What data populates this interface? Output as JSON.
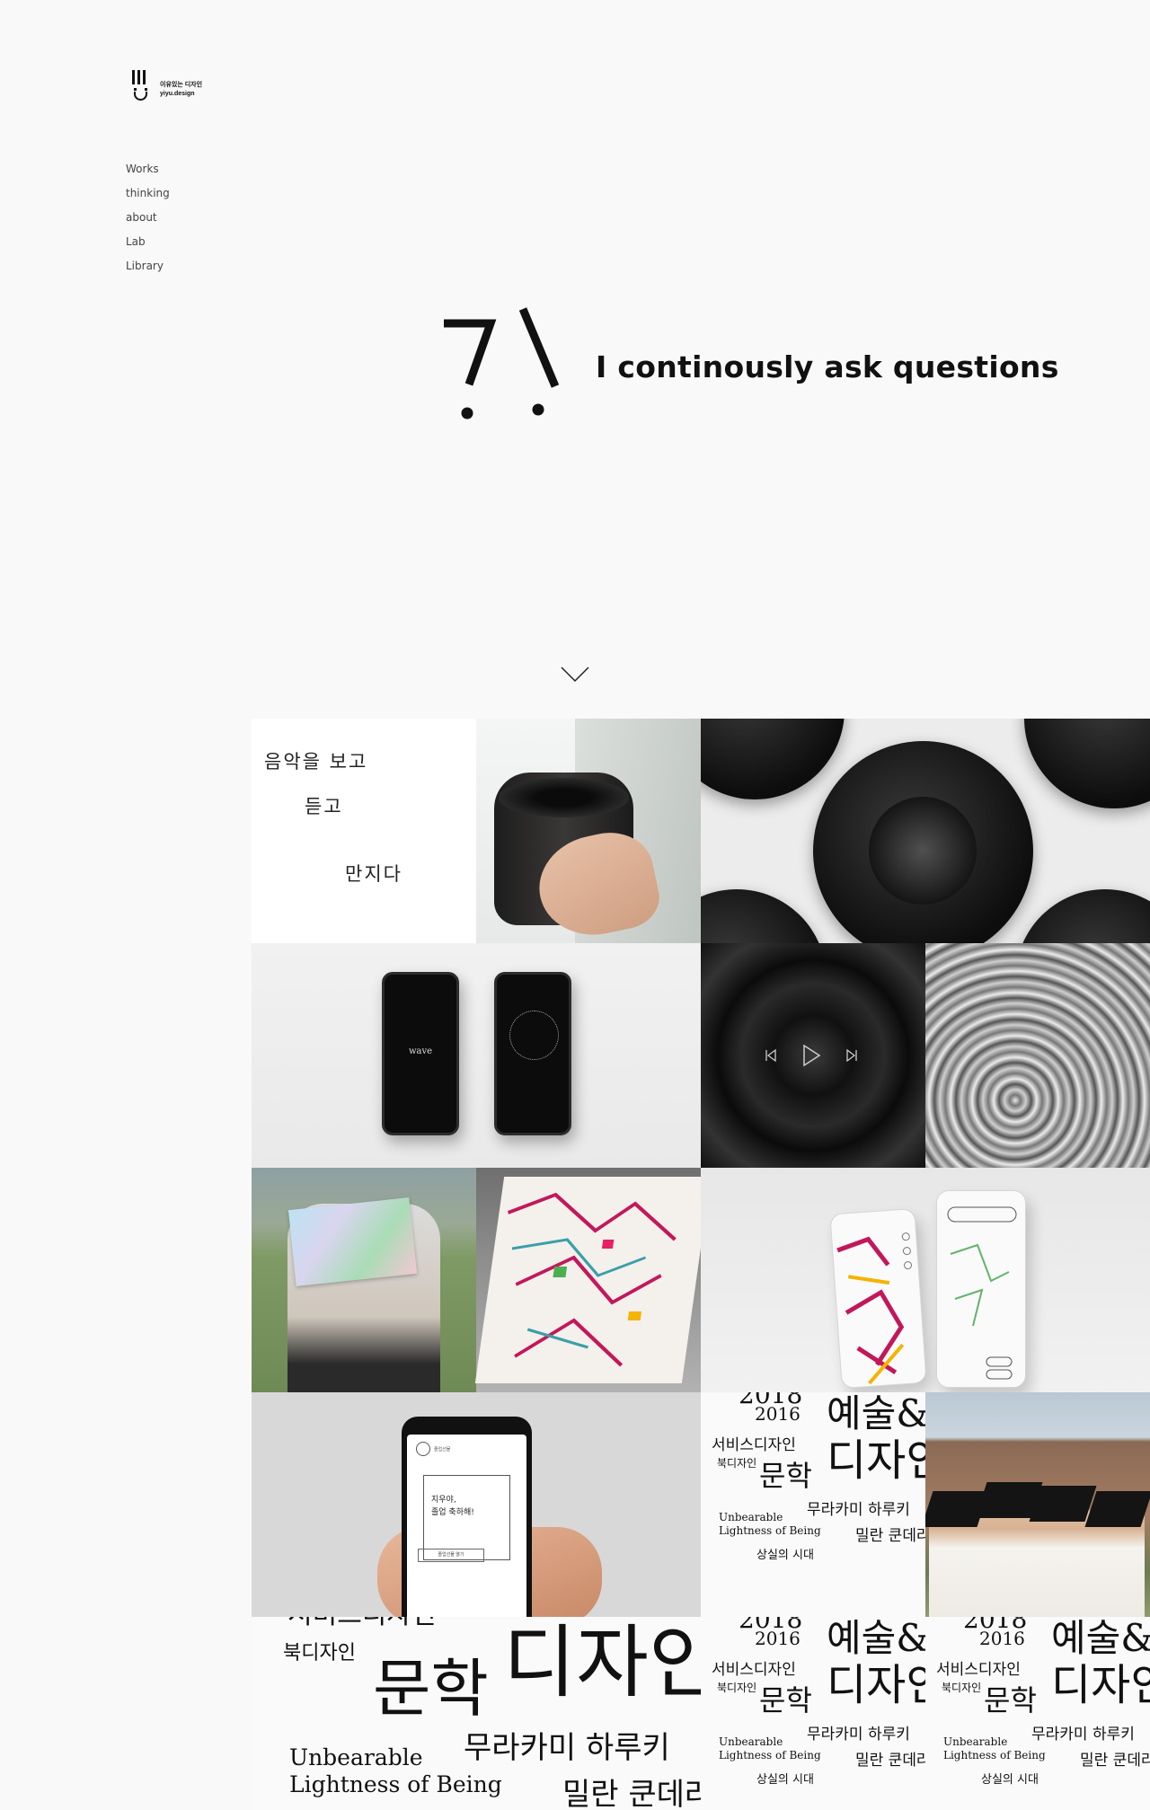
{
  "brand": {
    "name_ko": "이유있는 디자인",
    "name_en": "yiyu.design"
  },
  "nav": {
    "items": [
      {
        "label": "Works"
      },
      {
        "label": "thinking"
      },
      {
        "label": "about"
      },
      {
        "label": "Lab"
      },
      {
        "label": "Library"
      }
    ]
  },
  "hero": {
    "tagline": "I continously ask questions",
    "icon": "question-exclamation-mark"
  },
  "scroll": {
    "icon": "chevron-down-icon"
  },
  "works": {
    "music": {
      "line1": "음악을 보고",
      "line2": "듣고",
      "line3": "만지다"
    },
    "app": {
      "logo": "wave"
    },
    "graduation": {
      "header": "졸업선물",
      "greeting1": "지우야,",
      "greeting2": "졸업 축하해!",
      "button": "졸업선물 열기"
    },
    "poster": {
      "year1": "2018",
      "year2": "2016",
      "big1": "예술&",
      "big2": "디자인",
      "service": "서비스디자인",
      "book": "북디자인",
      "literature": "문학",
      "murakami": "무라카미 하루키",
      "unbearable1": "Unbearable",
      "unbearable2": "Lightness of Being",
      "kundera": "밀란 쿤데라",
      "era": "상실의 시대"
    }
  },
  "colors": {
    "background": "#f9f9f9",
    "text": "#222222",
    "accent": "#111111"
  }
}
